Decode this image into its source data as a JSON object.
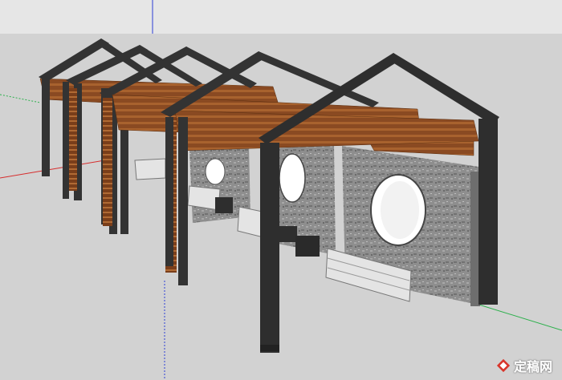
{
  "scene": {
    "sky_color": "#e6e6e6",
    "ground_color": "#d2d2d2",
    "steel_color": "#333333",
    "wood_color": "#8a4a22",
    "wall_color": "#8f8f8f",
    "bench_color": "#e4e4e4"
  },
  "watermark": {
    "brand_text": "定稿网",
    "logo_icon": "diamond-logo-icon"
  }
}
